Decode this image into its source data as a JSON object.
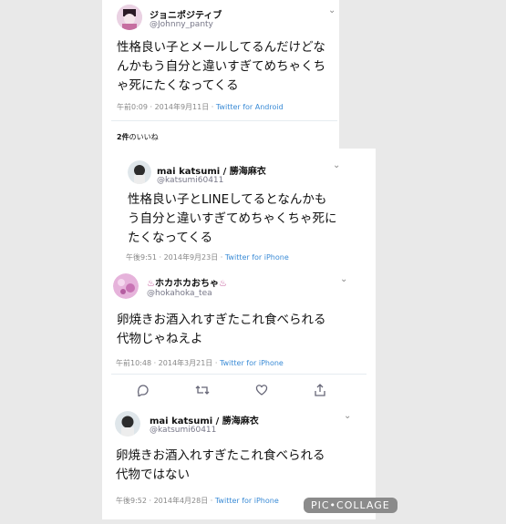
{
  "tweets": [
    {
      "name": "ジョニポジティブ",
      "handle": "@Johnny_panty",
      "lines": [
        "性格良い子とメールしてるんだけどな",
        "んかもう自分と違いすぎてめちゃくち",
        "ゃ死にたくなってくる"
      ],
      "time": "午前0:09 · 2014年9月11日 · ",
      "source": "Twitter for Android"
    },
    {
      "name": "mai katsumi / 勝海麻衣",
      "handle": "@katsumi60411",
      "lines": [
        "性格良い子とLINEしてるとなんかも",
        "う自分と違いすぎてめちゃくちゃ死に",
        "たくなってくる"
      ],
      "time": "午後9:51 · 2014年9月23日 · ",
      "source": "Twitter for iPhone"
    },
    {
      "name": "ホカホカおちゃ",
      "handle": "@hokahoka_tea",
      "lines": [
        "卵焼きお酒入れすぎたこれ食べられる",
        "代物じゃねえよ"
      ],
      "time": "午前10:48 · 2014年3月21日 · ",
      "source": "Twitter for iPhone"
    },
    {
      "name": "mai katsumi / 勝海麻衣",
      "handle": "@katsumi60411",
      "lines": [
        "卵焼きお酒入れすぎたこれ食べられる",
        "代物ではない"
      ],
      "time": "午後9:52 · 2014年4月28日 · ",
      "source": "Twitter for iPhone"
    }
  ],
  "likes": {
    "count": "2件",
    "label": "のいいね"
  },
  "chevron": "⌄",
  "icons": {
    "reply": "reply-icon",
    "retweet": "retweet-icon",
    "like": "heart-icon",
    "share": "share-icon"
  },
  "watermark": "PIC•COLLAGE"
}
